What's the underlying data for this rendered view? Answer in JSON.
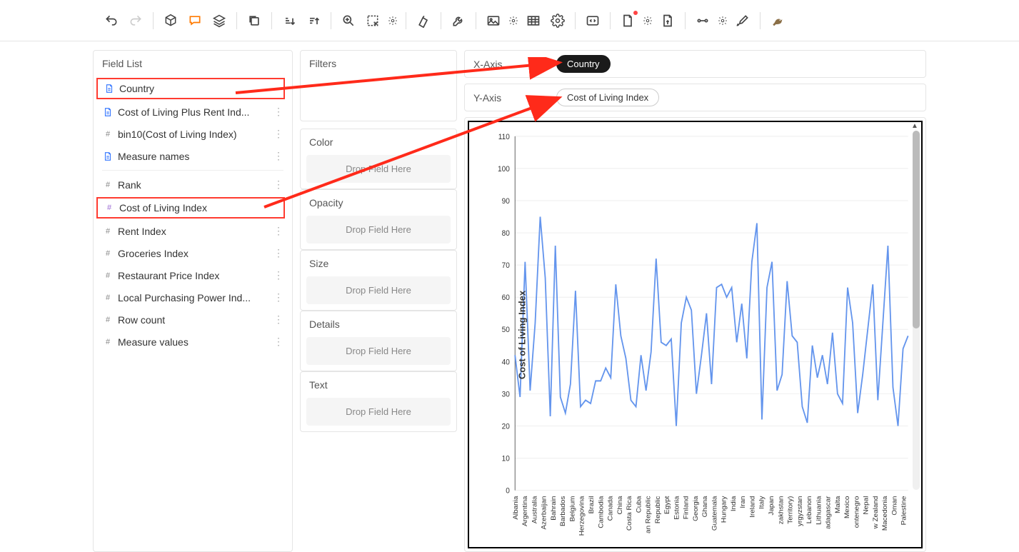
{
  "toolbar": {
    "icons": [
      "undo",
      "redo",
      "cube",
      "chat",
      "layers",
      "copy",
      "sort-asc",
      "sort-desc",
      "zoom",
      "resize",
      "gear-small",
      "paint",
      "wrench",
      "image",
      "gear-small2",
      "table",
      "settings",
      "code",
      "doc",
      "gear-small3",
      "export",
      "link",
      "gear-small4",
      "brush",
      "bird"
    ]
  },
  "field_list": {
    "title": "Field List",
    "fields": [
      {
        "type": "doc",
        "label": "Country",
        "highlight": true
      },
      {
        "type": "doc",
        "label": "Cost of Living Plus Rent Ind..."
      },
      {
        "type": "hash",
        "label": "bin10(Cost of Living Index)"
      },
      {
        "type": "doc",
        "label": "Measure names"
      },
      {
        "type": "divider"
      },
      {
        "type": "hash",
        "label": "Rank"
      },
      {
        "type": "hash-purple",
        "label": "Cost of Living Index",
        "highlight": true
      },
      {
        "type": "hash",
        "label": "Rent Index"
      },
      {
        "type": "hash",
        "label": "Groceries Index"
      },
      {
        "type": "hash",
        "label": "Restaurant Price Index"
      },
      {
        "type": "hash",
        "label": "Local Purchasing Power Ind..."
      },
      {
        "type": "hash",
        "label": "Row count"
      },
      {
        "type": "hash",
        "label": "Measure values"
      }
    ]
  },
  "config": {
    "filters_title": "Filters",
    "sections": [
      {
        "title": "Color",
        "placeholder": "Drop Field Here"
      },
      {
        "title": "Opacity",
        "placeholder": "Drop Field Here"
      },
      {
        "title": "Size",
        "placeholder": "Drop Field Here"
      },
      {
        "title": "Details",
        "placeholder": "Drop Field Here"
      },
      {
        "title": "Text",
        "placeholder": "Drop Field Here"
      }
    ]
  },
  "axes": {
    "x_label": "X-Axis",
    "x_pill": "Country",
    "y_label": "Y-Axis",
    "y_pill": "Cost of Living Index"
  },
  "chart_data": {
    "type": "line",
    "title": "",
    "xlabel": "",
    "ylabel": "Cost of Living Index",
    "ylim": [
      0,
      110
    ],
    "yticks": [
      0,
      10,
      20,
      30,
      40,
      50,
      60,
      70,
      80,
      90,
      100,
      110
    ],
    "categories": [
      "Albania",
      "Argentina",
      "Australia",
      "Azerbaijan",
      "Bahrain",
      "Barbados",
      "Belgium",
      "Herzegovina",
      "Brazil",
      "Cambodia",
      "Canada",
      "China",
      "Costa Rica",
      "Cuba",
      "an Republic",
      "Republic",
      "Egypt",
      "Estonia",
      "Finland",
      "Georgia",
      "Ghana",
      "Guatemala",
      "Hungary",
      "India",
      "Iran",
      "Ireland",
      "Italy",
      "Japan",
      "zakhstan",
      "Territory)",
      "yrgyzstan",
      "Lebanon",
      "Lithuania",
      "adagascar",
      "Malta",
      "Mexico",
      "ontenegro",
      "Nepal",
      "w Zealand",
      "Macedonia",
      "Oman",
      "Palestine"
    ],
    "values": [
      42,
      29,
      71,
      31,
      52,
      85,
      66,
      23,
      76,
      29,
      24,
      33,
      62,
      26,
      28,
      27,
      34,
      34,
      38,
      35,
      64,
      48,
      41,
      28,
      26,
      42,
      31,
      43,
      72,
      46,
      45,
      47,
      20,
      52,
      60,
      56,
      30,
      42,
      55,
      33,
      63,
      64,
      60,
      63,
      46,
      58,
      41,
      71,
      83,
      22,
      63,
      71,
      31,
      36,
      65,
      48,
      46,
      26,
      21,
      45,
      35,
      42,
      33,
      49,
      30,
      27,
      63,
      52,
      24,
      36,
      50,
      64,
      28,
      52,
      76,
      32,
      20,
      44,
      48
    ]
  }
}
